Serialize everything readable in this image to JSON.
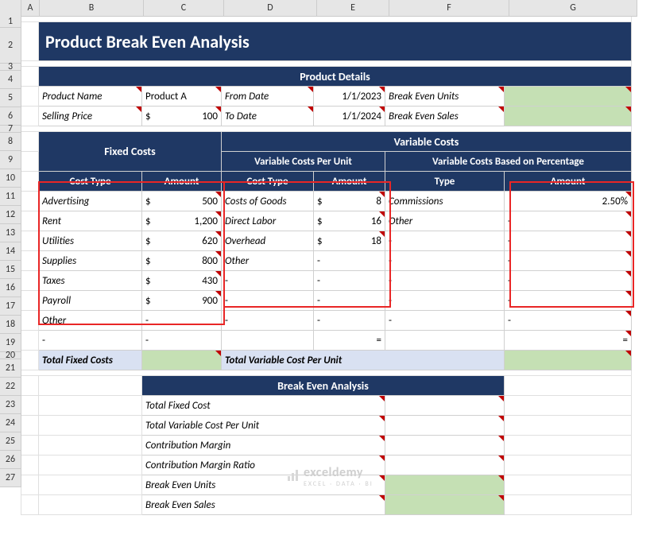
{
  "columns": [
    "A",
    "B",
    "C",
    "D",
    "E",
    "F",
    "G"
  ],
  "rows": [
    "1",
    "2",
    "3",
    "4",
    "5",
    "6",
    "7",
    "8",
    "9",
    "10",
    "11",
    "12",
    "13",
    "14",
    "15",
    "16",
    "17",
    "18",
    "19",
    "20",
    "21",
    "22",
    "23",
    "24",
    "25",
    "26",
    "27"
  ],
  "title": "Product Break Even Analysis",
  "product_details": {
    "header": "Product Details",
    "r1": {
      "l1": "Product Name",
      "v1": "Product A",
      "l2": "From Date",
      "v2": "1/1/2023",
      "l3": "Break Even Units"
    },
    "r2": {
      "l1": "Selling Price",
      "cur": "$",
      "v1": "100",
      "l2": "To Date",
      "v2": "1/1/2024",
      "l3": "Break Even Sales"
    }
  },
  "fixed": {
    "header": "Fixed Costs",
    "col1": "Cost Type",
    "col2": "Amount",
    "rows": [
      {
        "t": "Advertising",
        "a": "500"
      },
      {
        "t": "Rent",
        "a": "1,200"
      },
      {
        "t": "Utilities",
        "a": "620"
      },
      {
        "t": "Supplies",
        "a": "800"
      },
      {
        "t": "Taxes",
        "a": "430"
      },
      {
        "t": "Payroll",
        "a": "900"
      },
      {
        "t": "Other",
        "a": ""
      }
    ],
    "dash": "-",
    "total_label": "Total Fixed Costs"
  },
  "variable": {
    "header": "Variable Costs",
    "sub1": "Variable Costs Per Unit",
    "sub2": "Variable Costs Based on Percentage",
    "col1": "Cost Type",
    "col2": "Amount",
    "col3": "Type",
    "col4": "Amount",
    "perunit": [
      {
        "t": "Costs of Goods",
        "a": "8"
      },
      {
        "t": "Direct Labor",
        "a": "16"
      },
      {
        "t": "Overhead",
        "a": "18"
      },
      {
        "t": "Other",
        "a": ""
      }
    ],
    "pct": [
      {
        "t": "Commissions",
        "a": "2.50%"
      },
      {
        "t": "Other",
        "a": ""
      }
    ],
    "eq": "=",
    "total_label": "Total Variable Cost Per Unit"
  },
  "analysis": {
    "header": "Break Even Analysis",
    "rows": [
      "Total Fixed Cost",
      "Total Variable Cost Per Unit",
      "Contribution Margin",
      "Contribution Margin Ratio",
      "Break Even Units",
      "Break Even Sales"
    ]
  },
  "watermark": {
    "main": "exceldemy",
    "sub": "EXCEL · DATA · BI"
  },
  "cur": "$",
  "dash": "-"
}
